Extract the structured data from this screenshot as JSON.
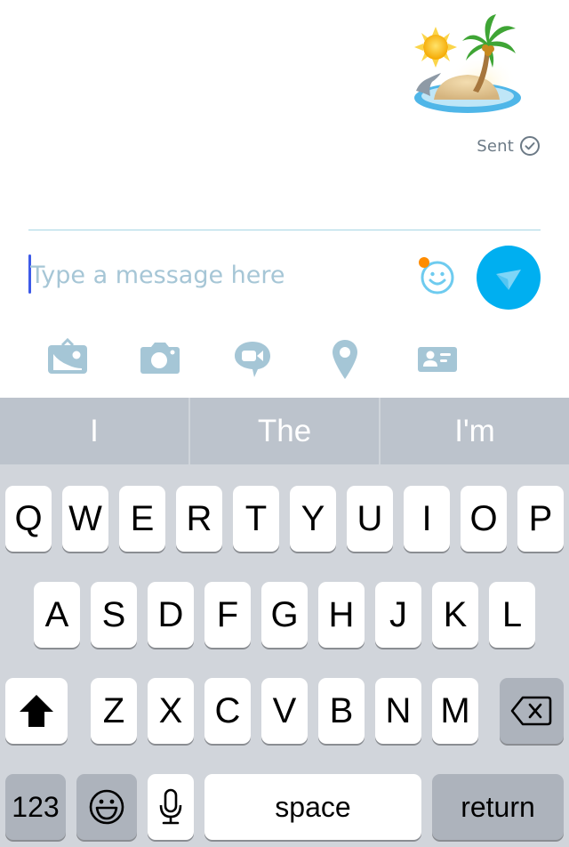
{
  "conversation": {
    "last_message": {
      "type": "sticker",
      "sticker_name": "island-sticker",
      "status": "Sent"
    }
  },
  "composer": {
    "placeholder": "Type a message here",
    "value": "",
    "emoji_notification_color": "#FF8C00",
    "send_button_color": "#00AFF0"
  },
  "actions": [
    {
      "name": "photo-gallery-button",
      "icon": "image-icon"
    },
    {
      "name": "camera-button",
      "icon": "camera-icon"
    },
    {
      "name": "video-message-button",
      "icon": "video-message-icon"
    },
    {
      "name": "location-button",
      "icon": "location-pin-icon"
    },
    {
      "name": "contact-card-button",
      "icon": "contact-card-icon"
    }
  ],
  "keyboard": {
    "suggestions": [
      "I",
      "The",
      "I'm"
    ],
    "row1": [
      "Q",
      "W",
      "E",
      "R",
      "T",
      "Y",
      "U",
      "I",
      "O",
      "P"
    ],
    "row2": [
      "A",
      "S",
      "D",
      "F",
      "G",
      "H",
      "J",
      "K",
      "L"
    ],
    "row3": [
      "Z",
      "X",
      "C",
      "V",
      "B",
      "N",
      "M"
    ],
    "numbers_label": "123",
    "space_label": "space",
    "return_label": "return"
  }
}
